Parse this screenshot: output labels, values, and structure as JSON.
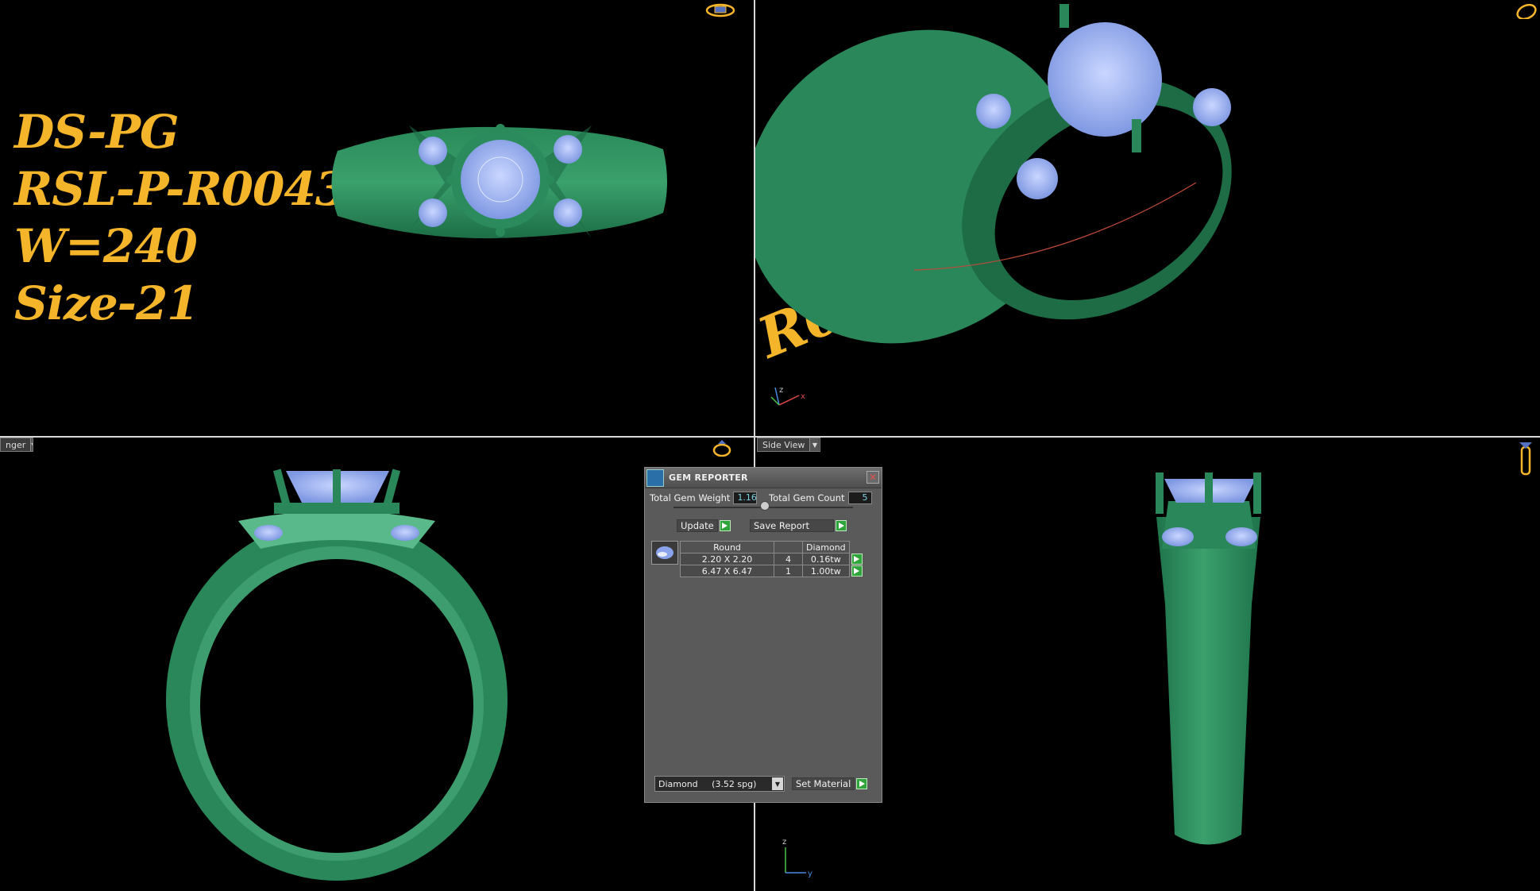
{
  "watermark": {
    "lines": [
      "DS-PG",
      "RSL-P-R0043",
      "W=240",
      "Size-21"
    ],
    "rotated_fragment": "R0043",
    "color": "#f5b52a"
  },
  "viewports": {
    "bottom_left": {
      "view_label": "nger"
    },
    "bottom_right": {
      "view_label": "Side View"
    }
  },
  "axes": {
    "x": "x",
    "y": "y",
    "z": "z"
  },
  "colors": {
    "metal": "#2e8a5e",
    "metal_light": "#5ab98a",
    "gem": "#9fb6f2",
    "accent_go": "#2fa43a"
  },
  "gem_reporter": {
    "title": "GEM REPORTER",
    "total_weight_label": "Total Gem Weight",
    "total_weight_value": "1.16",
    "total_count_label": "Total Gem Count",
    "total_count_value": "5",
    "update_label": "Update",
    "save_report_label": "Save Report",
    "table": {
      "headers": [
        "Round",
        "",
        "Diamond"
      ],
      "rows": [
        {
          "size": "2.20 X 2.20",
          "count": "4",
          "weight": "0.16tw"
        },
        {
          "size": "6.47 X 6.47",
          "count": "1",
          "weight": "1.00tw"
        }
      ]
    },
    "material_select": "Diamond     (3.52 spg)",
    "set_material_label": "Set Material",
    "close_icon": "close-icon"
  }
}
